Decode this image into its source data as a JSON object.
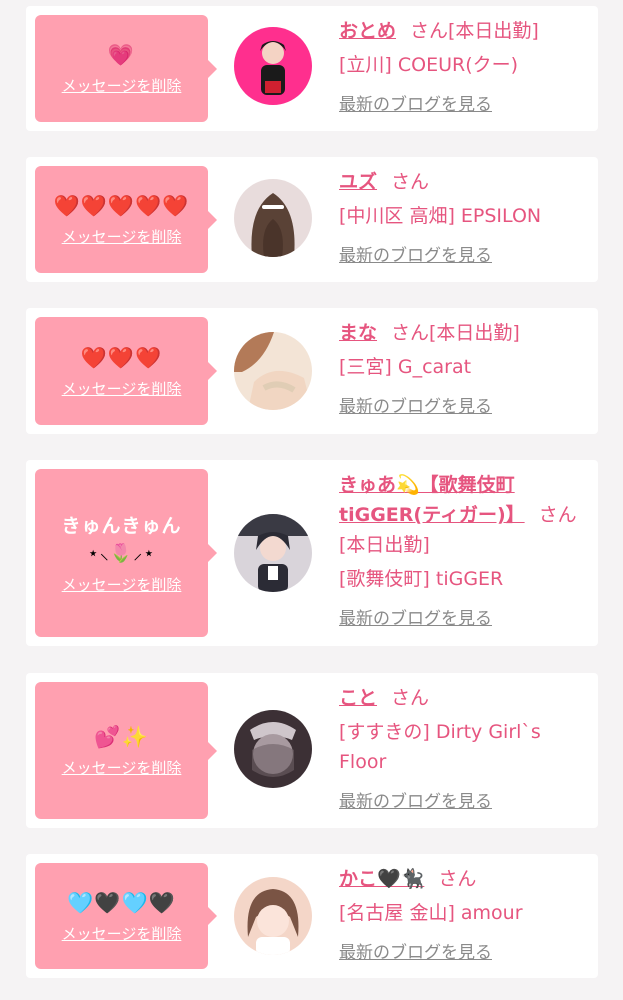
{
  "entries": [
    {
      "message": "",
      "emoji": "💗",
      "delete_label": "メッセージを削除",
      "name": "おとめ",
      "suffix": "さん[本日出勤]",
      "shop": "[立川] COEUR(クー)",
      "blog_label": "最新のブログを見る",
      "avatar_colors": [
        "#ff2f8e",
        "#1a1a1a"
      ]
    },
    {
      "message": "",
      "emoji": "❤️❤️❤️❤️❤️",
      "delete_label": "メッセージを削除",
      "name": "ユズ",
      "suffix": "さん",
      "shop": "[中川区 高畑] EPSILON",
      "blog_label": "最新のブログを見る",
      "avatar_colors": [
        "#e8dcdc",
        "#5a4236"
      ]
    },
    {
      "message": "",
      "emoji": "❤️❤️❤️",
      "delete_label": "メッセージを削除",
      "name": "まな",
      "suffix": "さん[本日出勤]",
      "shop": "[三宮] G_carat",
      "blog_label": "最新のブログを見る",
      "avatar_colors": [
        "#f3e4d6",
        "#b37a58"
      ]
    },
    {
      "message": "きゅんきゅん",
      "emoji": "⋆⸜🌷⸝⋆",
      "delete_label": "メッセージを削除",
      "name": "きゅあ💫【歌舞伎町tiGGER(ティガー)】",
      "suffix": "さん[本日出勤]",
      "shop": "[歌舞伎町] tiGGER",
      "blog_label": "最新のブログを見る",
      "avatar_colors": [
        "#d9d4da",
        "#2b2b35"
      ]
    },
    {
      "message": "",
      "emoji": "💕✨",
      "delete_label": "メッセージを削除",
      "name": "こと",
      "suffix": "さん",
      "shop": "[すすきの] Dirty Girl`s Floor",
      "blog_label": "最新のブログを見る",
      "avatar_colors": [
        "#3c3035",
        "#a89aa0"
      ]
    },
    {
      "message": "",
      "emoji": "🩵🖤🩵🖤",
      "delete_label": "メッセージを削除",
      "name": "かこ🖤🐈‍⬛",
      "suffix": "さん",
      "shop": "[名古屋 金山] amour",
      "blog_label": "最新のブログを見る",
      "avatar_colors": [
        "#f4d6c8",
        "#7a5444"
      ]
    }
  ]
}
